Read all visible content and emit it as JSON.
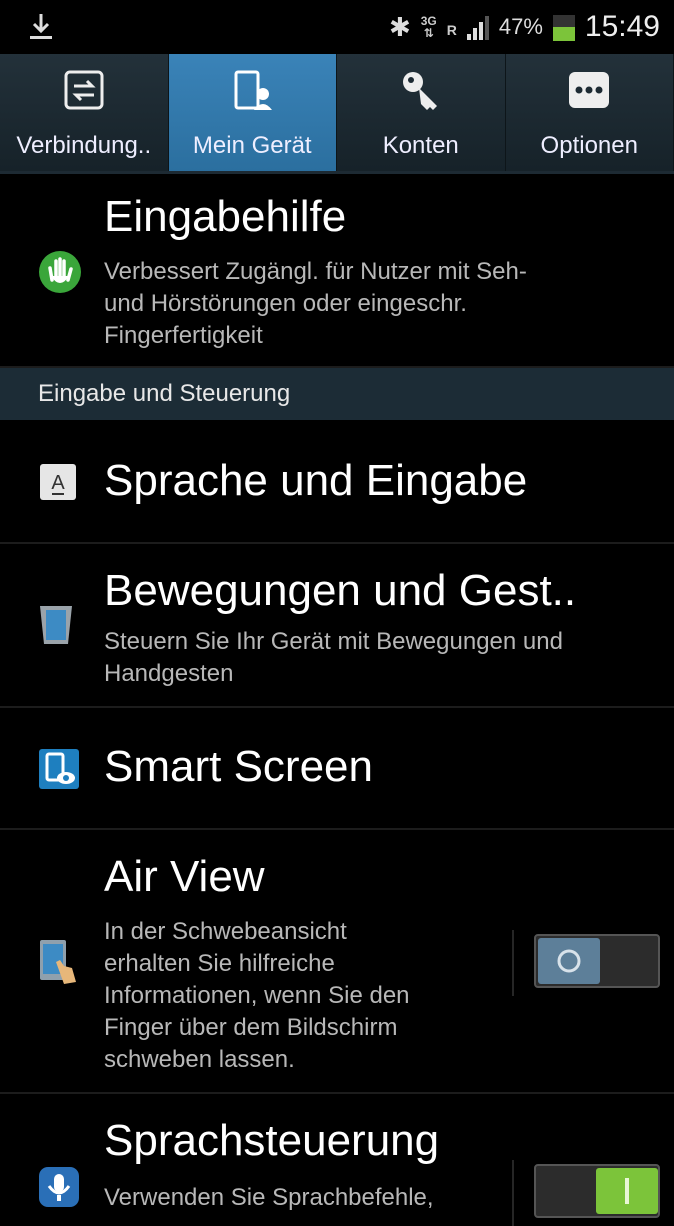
{
  "status_bar": {
    "network": "3G",
    "roaming": "R",
    "battery_percent": "47%",
    "time": "15:49"
  },
  "tabs": [
    {
      "label": "Verbindung..",
      "active": false
    },
    {
      "label": "Mein Gerät",
      "active": true
    },
    {
      "label": "Konten",
      "active": false
    },
    {
      "label": "Optionen",
      "active": false
    }
  ],
  "items": {
    "accessibility": {
      "title": "Eingabehilfe",
      "subtitle": [
        "Verbessert Zugängl. für Nutzer mit Seh-",
        "und Hörstörungen oder eingeschr.",
        "Fingerfertigkeit"
      ]
    },
    "section_input": "Eingabe und Steuerung",
    "language": {
      "title": "Sprache und Eingabe"
    },
    "motions": {
      "title": "Bewegungen und Gest..",
      "subtitle": [
        "Steuern Sie Ihr Gerät mit Bewegungen und",
        "Handgesten"
      ]
    },
    "smart_screen": {
      "title": "Smart Screen"
    },
    "air_view": {
      "title": "Air View",
      "subtitle": [
        "In der Schwebeansicht",
        "erhalten Sie hilfreiche",
        "Informationen, wenn Sie den",
        "Finger über dem Bildschirm",
        "schweben lassen."
      ],
      "toggle_on": false
    },
    "voice_control": {
      "title": "Sprachsteuerung",
      "subtitle": [
        "Verwenden Sie Sprachbefehle,"
      ],
      "toggle_on": true
    }
  },
  "colors": {
    "active_tab": "#3a83b8",
    "section_bg": "#1c2c36",
    "toggle_on": "#7cc43a",
    "toggle_off_knob": "#5d7f99"
  }
}
